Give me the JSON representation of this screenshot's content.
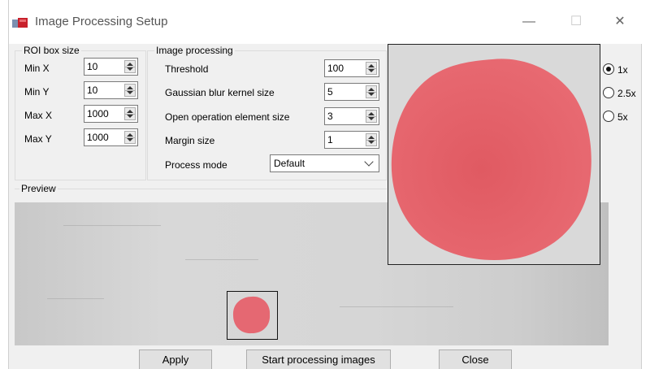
{
  "window": {
    "title": "Image Processing Setup",
    "controls": {
      "minimize": "—",
      "maximize": "☐",
      "close": "✕"
    }
  },
  "roi": {
    "group_label": "ROI box size",
    "fields": [
      {
        "label": "Min X",
        "value": "10"
      },
      {
        "label": "Min Y",
        "value": "10"
      },
      {
        "label": "Max X",
        "value": "1000"
      },
      {
        "label": "Max Y",
        "value": "1000"
      }
    ]
  },
  "processing": {
    "group_label": "Image processing",
    "fields": [
      {
        "label": "Threshold",
        "value": "100"
      },
      {
        "label": "Gaussian blur kernel size",
        "value": "5"
      },
      {
        "label": "Open operation element size",
        "value": "3"
      },
      {
        "label": "Margin size",
        "value": "1"
      }
    ],
    "mode_label": "Process mode",
    "mode_value": "Default"
  },
  "zoom": {
    "options": [
      "1x",
      "2.5x",
      "5x"
    ],
    "selected": "1x"
  },
  "preview": {
    "label": "Preview"
  },
  "buttons": {
    "apply": "Apply",
    "start": "Start processing images",
    "close": "Close"
  },
  "colors": {
    "overlay": "#e85560",
    "window_bg": "#f0f0f0"
  }
}
